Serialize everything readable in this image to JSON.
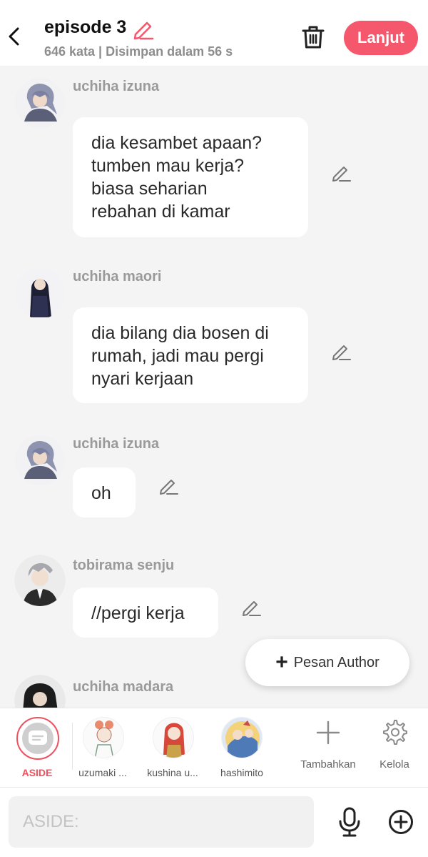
{
  "header": {
    "title": "episode 3",
    "subtitle": "646 kata | Disimpan dalam 56 s",
    "next_label": "Lanjut"
  },
  "messages": [
    {
      "sender": "uchiha izuna",
      "lines": [
        "dia kesambet apaan?",
        "tumben mau kerja?",
        "biasa seharian",
        "rebahan di kamar"
      ]
    },
    {
      "sender": "uchiha maori",
      "lines": [
        "dia bilang dia bosen di",
        "rumah, jadi mau pergi",
        "nyari kerjaan"
      ]
    },
    {
      "sender": "uchiha izuna",
      "lines": [
        "oh"
      ]
    },
    {
      "sender": "tobirama senju",
      "lines": [
        "//pergi kerja"
      ]
    },
    {
      "sender": "uchiha madara",
      "lines": []
    }
  ],
  "fab": {
    "label": "Pesan Author"
  },
  "charbar": {
    "items": [
      {
        "label": "ASIDE",
        "color": "#f0505e"
      },
      {
        "label": "uzumaki ..."
      },
      {
        "label": "kushina u..."
      },
      {
        "label": "hashimito"
      }
    ],
    "add_label": "Tambahkan",
    "manage_label": "Kelola"
  },
  "input": {
    "placeholder": "ASIDE:"
  },
  "colors": {
    "accent": "#f5576c",
    "background": "#f4f4f4"
  },
  "icons": [
    "back-icon",
    "pencil-icon",
    "trash-icon",
    "plus-icon",
    "gear-icon",
    "microphone-icon",
    "add-circle-icon"
  ]
}
